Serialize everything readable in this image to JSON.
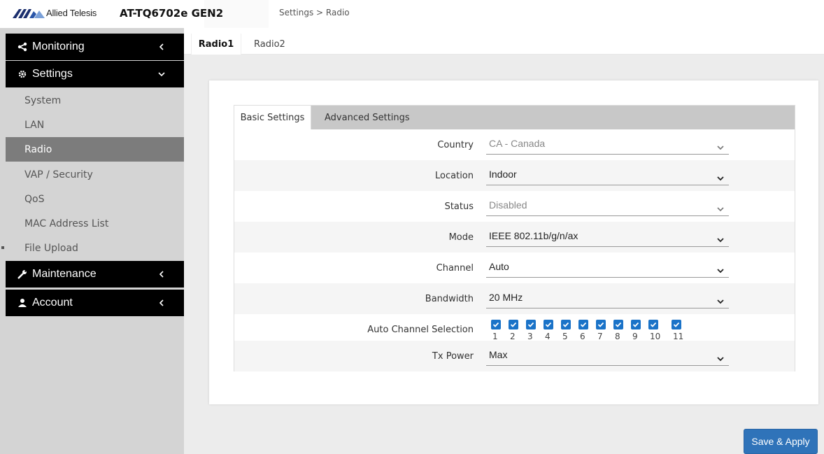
{
  "header": {
    "brand": "Allied Telesis",
    "model": "AT-TQ6702e GEN2",
    "breadcrumb": "Settings > Radio"
  },
  "sidebar": {
    "monitoring": "Monitoring",
    "settings": "Settings",
    "settings_items": [
      "System",
      "LAN",
      "Radio",
      "VAP / Security",
      "QoS",
      "MAC Address List",
      "File Upload"
    ],
    "active_item": "Radio",
    "maintenance": "Maintenance",
    "account": "Account"
  },
  "radio_tabs": [
    "Radio1",
    "Radio2"
  ],
  "active_radio_tab": "Radio1",
  "form_tabs": [
    "Basic Settings",
    "Advanced Settings"
  ],
  "active_form_tab": "Basic Settings",
  "fields": {
    "country": {
      "label": "Country",
      "value": "CA - Canada"
    },
    "location": {
      "label": "Location",
      "value": "Indoor"
    },
    "status": {
      "label": "Status",
      "value": "Disabled"
    },
    "mode": {
      "label": "Mode",
      "value": "IEEE 802.11b/g/n/ax"
    },
    "channel": {
      "label": "Channel",
      "value": "Auto"
    },
    "bandwidth": {
      "label": "Bandwidth",
      "value": "20 MHz"
    },
    "auto_channel": {
      "label": "Auto Channel Selection",
      "channels": [
        "1",
        "2",
        "3",
        "4",
        "5",
        "6",
        "7",
        "8",
        "9",
        "10",
        "11"
      ],
      "all_checked": true
    },
    "tx_power": {
      "label": "Tx Power",
      "value": "Max"
    }
  },
  "save_button": "Save & Apply",
  "colors": {
    "accent": "#2f73b9",
    "checkbox": "#1a73c8",
    "sidebar_dark": "#000000",
    "sidebar_bg": "#d4d4d4",
    "active_item": "#7c7c7c"
  },
  "icons": {
    "monitoring": "share-icon",
    "settings": "gear-icon",
    "maintenance": "wrench-icon",
    "account": "user-icon",
    "chevron": "chevron-icon",
    "dropdown": "chevron-down-icon",
    "checkbox": "check-icon"
  }
}
